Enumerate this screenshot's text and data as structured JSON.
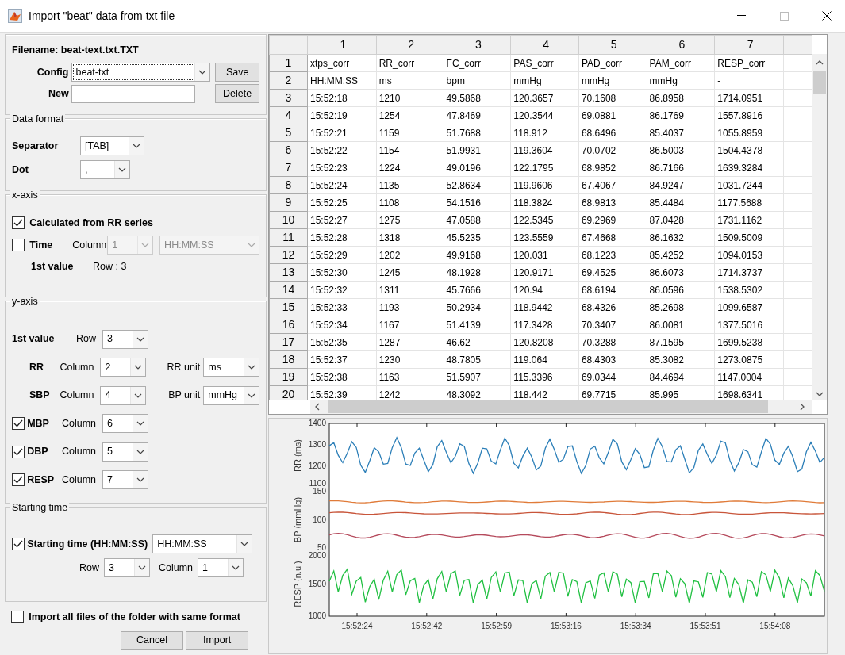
{
  "window": {
    "title": "Import \"beat\" data from txt file"
  },
  "file": {
    "filename": "Filename: beat-text.txt.TXT",
    "config_label": "Config",
    "config_value": "beat-txt",
    "save": "Save",
    "new_label": "New",
    "delete": "Delete"
  },
  "data_format": {
    "title": "Data format",
    "separator_label": "Separator",
    "separator_value": "[TAB]",
    "dot_label": "Dot",
    "dot_value": ","
  },
  "x_axis": {
    "title": "x-axis",
    "calculated": {
      "label": "Calculated from RR series",
      "checked": true
    },
    "time": {
      "label": "Time",
      "checked": false,
      "column_label": "Column",
      "column_value": "1",
      "format": "HH:MM:SS",
      "disabled": true
    },
    "first_value_label": "1st value",
    "first_value_text": "Row : 3"
  },
  "y_axis": {
    "title": "y-axis",
    "rows": [
      {
        "kind": "plain",
        "label": "1st value",
        "field_label": "Row",
        "value": "3"
      },
      {
        "kind": "plain",
        "label": "RR",
        "field_label": "Column",
        "value": "2",
        "unit_label": "RR unit",
        "unit": "ms"
      },
      {
        "kind": "plain",
        "label": "SBP",
        "field_label": "Column",
        "value": "4",
        "unit_label": "BP unit",
        "unit": "mmHg"
      },
      {
        "kind": "check",
        "label": "MBP",
        "checked": true,
        "field_label": "Column",
        "value": "6"
      },
      {
        "kind": "check",
        "label": "DBP",
        "checked": true,
        "field_label": "Column",
        "value": "5"
      },
      {
        "kind": "check",
        "label": "RESP",
        "checked": true,
        "field_label": "Column",
        "value": "7"
      }
    ]
  },
  "starting_time": {
    "title": "Starting time",
    "label": "Starting time (HH:MM:SS)",
    "checked": true,
    "format": "HH:MM:SS",
    "row_label": "Row",
    "row_value": "3",
    "column_label": "Column",
    "column_value": "1"
  },
  "import_all": {
    "label": "Import all files of the folder with same format",
    "checked": false
  },
  "buttons": [
    {
      "label": "Cancel"
    },
    {
      "label": "Import"
    }
  ],
  "table": {
    "columns": [
      "1",
      "2",
      "3",
      "4",
      "5",
      "6",
      "7"
    ],
    "rows": [
      {
        "header": "1",
        "cells": [
          "xtps_corr",
          "RR_corr",
          "FC_corr",
          "PAS_corr",
          "PAD_corr",
          "PAM_corr",
          "RESP_corr"
        ]
      },
      {
        "header": "2",
        "cells": [
          "HH:MM:SS",
          "ms",
          "bpm",
          "mmHg",
          "mmHg",
          "mmHg",
          "-"
        ]
      },
      {
        "header": "3",
        "cells": [
          "15:52:18",
          "1210",
          "49.5868",
          "120.3657",
          "70.1608",
          "86.8958",
          "1714.0951"
        ]
      },
      {
        "header": "4",
        "cells": [
          "15:52:19",
          "1254",
          "47.8469",
          "120.3544",
          "69.0881",
          "86.1769",
          "1557.8916"
        ]
      },
      {
        "header": "5",
        "cells": [
          "15:52:21",
          "1159",
          "51.7688",
          "118.912",
          "68.6496",
          "85.4037",
          "1055.8959"
        ]
      },
      {
        "header": "6",
        "cells": [
          "15:52:22",
          "1154",
          "51.9931",
          "119.3604",
          "70.0702",
          "86.5003",
          "1504.4378"
        ]
      },
      {
        "header": "7",
        "cells": [
          "15:52:23",
          "1224",
          "49.0196",
          "122.1795",
          "68.9852",
          "86.7166",
          "1639.3284"
        ]
      },
      {
        "header": "8",
        "cells": [
          "15:52:24",
          "1135",
          "52.8634",
          "119.9606",
          "67.4067",
          "84.9247",
          "1031.7244"
        ]
      },
      {
        "header": "9",
        "cells": [
          "15:52:25",
          "1108",
          "54.1516",
          "118.3824",
          "68.9813",
          "85.4484",
          "1177.5688"
        ]
      },
      {
        "header": "10",
        "cells": [
          "15:52:27",
          "1275",
          "47.0588",
          "122.5345",
          "69.2969",
          "87.0428",
          "1731.1162"
        ]
      },
      {
        "header": "11",
        "cells": [
          "15:52:28",
          "1318",
          "45.5235",
          "123.5559",
          "67.4668",
          "86.1632",
          "1509.5009"
        ]
      },
      {
        "header": "12",
        "cells": [
          "15:52:29",
          "1202",
          "49.9168",
          "120.031",
          "68.1223",
          "85.4252",
          "1094.0153"
        ]
      },
      {
        "header": "13",
        "cells": [
          "15:52:30",
          "1245",
          "48.1928",
          "120.9171",
          "69.4525",
          "86.6073",
          "1714.3737"
        ]
      },
      {
        "header": "14",
        "cells": [
          "15:52:32",
          "1311",
          "45.7666",
          "120.94",
          "68.6194",
          "86.0596",
          "1538.5302"
        ]
      },
      {
        "header": "15",
        "cells": [
          "15:52:33",
          "1193",
          "50.2934",
          "118.9442",
          "68.4326",
          "85.2698",
          "1099.6587"
        ]
      },
      {
        "header": "16",
        "cells": [
          "15:52:34",
          "1167",
          "51.4139",
          "117.3428",
          "70.3407",
          "86.0081",
          "1377.5016"
        ]
      },
      {
        "header": "17",
        "cells": [
          "15:52:35",
          "1287",
          "46.62",
          "120.8208",
          "70.3288",
          "87.1595",
          "1699.5238"
        ]
      },
      {
        "header": "18",
        "cells": [
          "15:52:37",
          "1230",
          "48.7805",
          "119.064",
          "68.4303",
          "85.3082",
          "1273.0875"
        ]
      },
      {
        "header": "19",
        "cells": [
          "15:52:38",
          "1163",
          "51.5907",
          "115.3396",
          "69.0344",
          "84.4694",
          "1147.0004"
        ]
      },
      {
        "header": "20",
        "cells": [
          "15:52:39",
          "1242",
          "48.3092",
          "118.442",
          "69.7715",
          "85.995",
          "1698.6341"
        ]
      }
    ]
  },
  "plot": {
    "xticks": [
      "15:52:24",
      "15:52:42",
      "15:52:59",
      "15:53:16",
      "15:53:34",
      "15:53:51",
      "15:54:08"
    ],
    "panels": [
      {
        "ylabel": "RR (ms)",
        "yticks": [
          "1400",
          "1300",
          "1200",
          "1100"
        ],
        "traces": [
          {
            "color": "#2c7fb8"
          }
        ]
      },
      {
        "ylabel": "BP (mmHg)",
        "yticks": [
          "150",
          "100",
          "50"
        ],
        "traces": [
          {
            "color": "#b54a5c"
          },
          {
            "color": "#c8553a"
          },
          {
            "color": "#e07b39"
          }
        ]
      },
      {
        "ylabel": "RESP (n.u.)",
        "yticks": [
          "2000",
          "1500",
          "1000"
        ],
        "traces": [
          {
            "color": "#21c042"
          }
        ]
      }
    ]
  }
}
